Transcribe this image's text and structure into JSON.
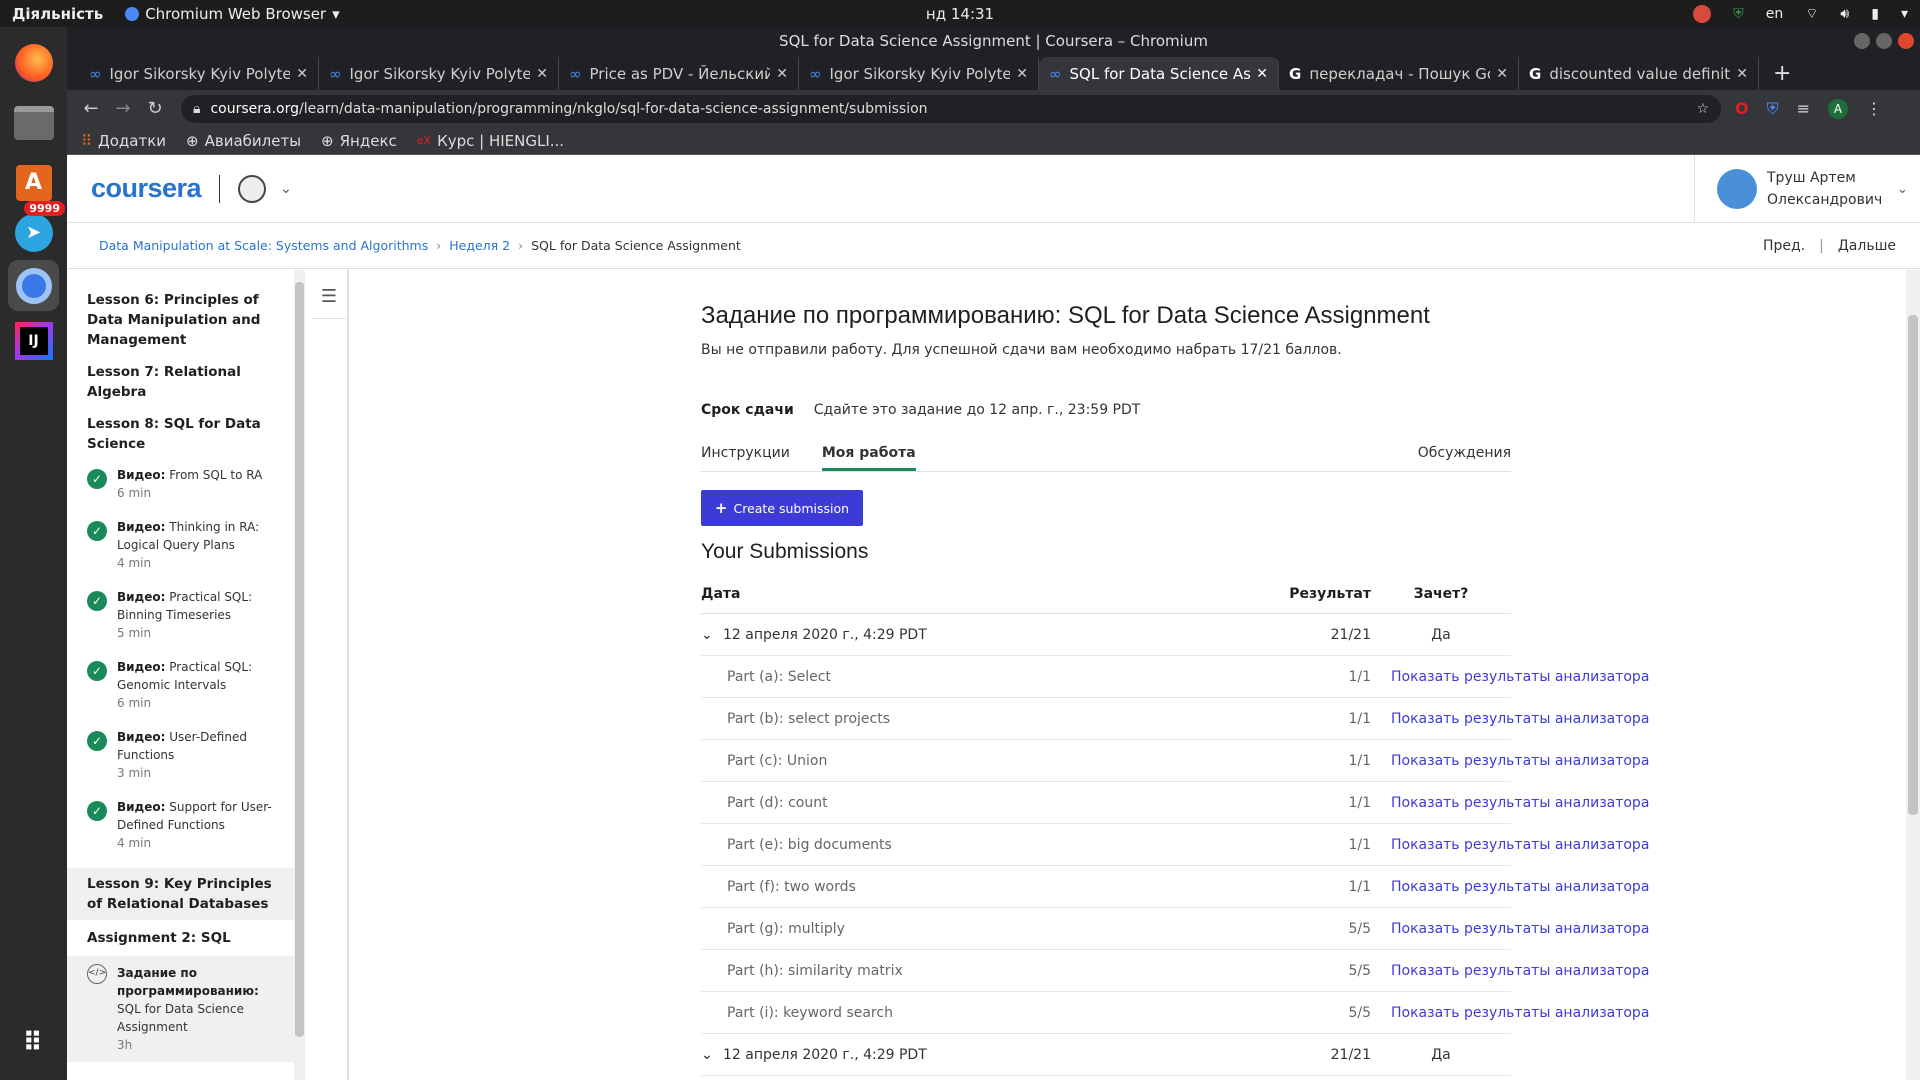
{
  "os": {
    "activities": "Діяльність",
    "app_name": "Chromium Web Browser",
    "clock": "нд 14:31",
    "lang": "en",
    "dock_badge": "9999"
  },
  "browser": {
    "window_title": "SQL for Data Science Assignment | Coursera – Chromium",
    "tabs": [
      {
        "label": "Igor Sikorsky Kyiv Polytech"
      },
      {
        "label": "Igor Sikorsky Kyiv Polytech"
      },
      {
        "label": "Price as PDV - Йельский у"
      },
      {
        "label": "Igor Sikorsky Kyiv Polytech"
      },
      {
        "label": "SQL for Data Science Assig"
      },
      {
        "label": "перекладач - Пошук Goo"
      },
      {
        "label": "discounted value definitio"
      }
    ],
    "url_host": "coursera.org",
    "url_path": "/learn/data-manipulation/programming/nkglo/sql-for-data-science-assignment/submission",
    "profile_initial": "A",
    "bookmarks": [
      "Додатки",
      "Авиабилеты",
      "Яндекс",
      "Курс | HIENGLI..."
    ]
  },
  "header": {
    "logo": "coursera",
    "user_name": "Труш Артем Олександрович"
  },
  "breadcrumb": {
    "course": "Data Manipulation at Scale: Systems and Algorithms",
    "week": "Неделя 2",
    "current": "SQL for Data Science Assignment",
    "prev": "Пред.",
    "next": "Дальше"
  },
  "sidebar": {
    "lesson6": "Lesson 6: Principles of Data Manipulation and Management",
    "lesson7": "Lesson 7: Relational Algebra",
    "lesson8": "Lesson 8: SQL for Data Science",
    "video_prefix": "Видео:",
    "items": [
      {
        "title": "From SQL to RA",
        "duration": "6 min"
      },
      {
        "title": "Thinking in RA: Logical Query Plans",
        "duration": "4 min"
      },
      {
        "title": "Practical SQL: Binning Timeseries",
        "duration": "5 min"
      },
      {
        "title": "Practical SQL: Genomic Intervals",
        "duration": "6 min"
      },
      {
        "title": "User-Defined Functions",
        "duration": "3 min"
      },
      {
        "title": "Support for User-Defined Functions",
        "duration": "4 min"
      }
    ],
    "lesson9": "Lesson 9: Key Principles of Relational Databases",
    "assignment": "Assignment 2: SQL",
    "current_item_prefix": "Задание по программированию:",
    "current_item_title": "SQL for Data Science Assignment",
    "current_item_duration": "3h"
  },
  "main": {
    "title": "Задание по программированию: SQL for Data Science Assignment",
    "subtitle": "Вы не отправили работу. Для успешной сдачи вам необходимо набрать 17/21 баллов.",
    "deadline_label": "Срок сдачи",
    "deadline_value": "Сдайте это задание до 12 апр. г., 23:59 PDT",
    "tabs": {
      "instructions": "Инструкции",
      "my_work": "Моя работа",
      "discussions": "Обсуждения"
    },
    "create_button": "Create submission",
    "submissions_title": "Your Submissions",
    "table_headers": {
      "date": "Дата",
      "result": "Результат",
      "passed": "Зачет?"
    },
    "submissions": [
      {
        "date": "12 апреля 2020 г., 4:29 PDT",
        "result": "21/21",
        "passed": "Да"
      },
      {
        "date": "12 апреля 2020 г., 4:29 PDT",
        "result": "21/21",
        "passed": "Да"
      }
    ],
    "link_text": "Показать результаты анализатора",
    "parts": [
      {
        "name": "Part (a): Select",
        "score": "1/1"
      },
      {
        "name": "Part (b): select projects",
        "score": "1/1"
      },
      {
        "name": "Part (c): Union",
        "score": "1/1"
      },
      {
        "name": "Part (d): count",
        "score": "1/1"
      },
      {
        "name": "Part (e): big documents",
        "score": "1/1"
      },
      {
        "name": "Part (f): two words",
        "score": "1/1"
      },
      {
        "name": "Part (g): multiply",
        "score": "5/5"
      },
      {
        "name": "Part (h): similarity matrix",
        "score": "5/5"
      },
      {
        "name": "Part (i): keyword search",
        "score": "5/5"
      }
    ]
  }
}
